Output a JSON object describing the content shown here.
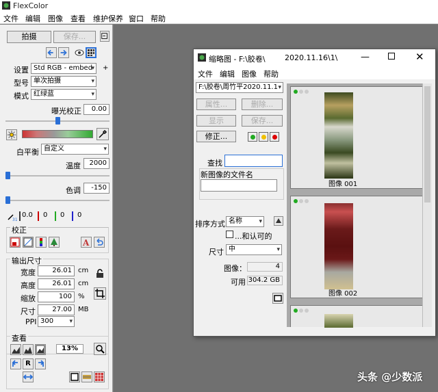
{
  "app": {
    "title": "FlexColor"
  },
  "menu": [
    "文件",
    "编辑",
    "图像",
    "查看",
    "维护保养",
    "窗口",
    "帮助"
  ],
  "left_panel": {
    "capture_label": "拍摄",
    "save_label": "保存...",
    "settings_label": "设置",
    "settings_value": "Std RGB - embed",
    "model_label": "型号",
    "model_value": "单次拍摄",
    "mode_label": "模式",
    "mode_value": "红绿蓝",
    "exposure_label": "曝光校正",
    "exposure_value": "0.00",
    "exposure_level": 0.5,
    "wb_label": "白平衡",
    "wb_value": "自定义",
    "temp_label": "温度",
    "temp_value": "2000",
    "temp_level": 0.0,
    "tint_label": "色调",
    "tint_value": "-150",
    "tint_level": 0.0,
    "picker_values": [
      "0.0",
      "0",
      "0",
      "0"
    ],
    "correction_label": "校正",
    "output_label": "输出尺寸",
    "width_label": "宽度",
    "width_value": "26.01",
    "width_unit": "cm",
    "height_label": "高度",
    "height_value": "26.01",
    "height_unit": "cm",
    "scale_label": "缩放",
    "scale_value": "100",
    "scale_unit": "%",
    "size_label": "尺寸",
    "size_value": "27.00",
    "size_unit": "MB",
    "ppi_label": "PPI",
    "ppi_value": "300",
    "view_label": "查看",
    "zoom_value": "13%",
    "r_label": "R"
  },
  "thumb_window": {
    "title": "缩略图 - F:\\胶卷\\",
    "title_suffix": "2020.11.16\\1\\",
    "menu": [
      "文件",
      "编辑",
      "图像",
      "帮助"
    ],
    "path_value": "F:\\胶卷\\周竹平2020.11.1",
    "properties_label": "属性...",
    "delete_label": "删除...",
    "show_label": "显示",
    "save_label": "保存...",
    "fix_label": "修正...",
    "find_label": "查找",
    "find_value": "",
    "newname_label": "新图像的文件名",
    "sort_label": "排序方式",
    "sort_value": "名称",
    "approved_label": "...和认可的",
    "size_label": "尺寸",
    "size_value": "中",
    "images_label": "图像：",
    "images_value": "4",
    "available_label": "可用",
    "available_value": "304.2 GB",
    "thumbs": [
      {
        "label": "图像 001"
      },
      {
        "label": "图像 002"
      }
    ]
  },
  "watermark": "头条 @少数派",
  "colors": {
    "workspace": "#707070",
    "accent": "#2a6fd6"
  }
}
